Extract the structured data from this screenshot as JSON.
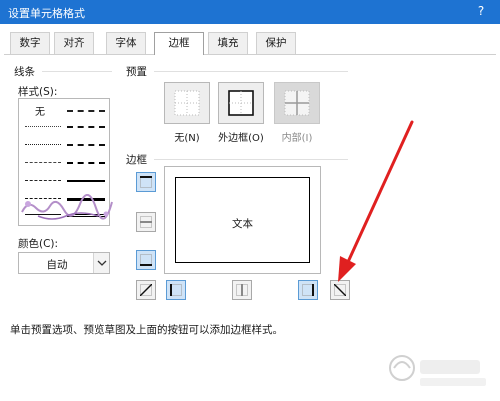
{
  "window": {
    "title": "设置单元格格式",
    "help": "?"
  },
  "tabs": [
    {
      "label": "数字"
    },
    {
      "label": "对齐"
    },
    {
      "label": "字体"
    },
    {
      "label": "边框",
      "active": true
    },
    {
      "label": "填充"
    },
    {
      "label": "保护"
    }
  ],
  "line_section": {
    "title": "线条",
    "style_label": "样式(S):",
    "none_label": "无",
    "color_label": "颜色(C):",
    "color_value": "自动"
  },
  "presets": {
    "title": "预置",
    "items": [
      {
        "label": "无(N)",
        "enabled": true
      },
      {
        "label": "外边框(O)",
        "enabled": true
      },
      {
        "label": "内部(I)",
        "enabled": false
      }
    ]
  },
  "border_section": {
    "title": "边框",
    "preview_text": "文本"
  },
  "hint_text": "单击预置选项、预览草图及上面的按钮可以添加边框样式。",
  "colors": {
    "titlebar": "#1e73d2",
    "active_border_button": "#cfe3f7",
    "annotation_arrow": "#e02020"
  }
}
